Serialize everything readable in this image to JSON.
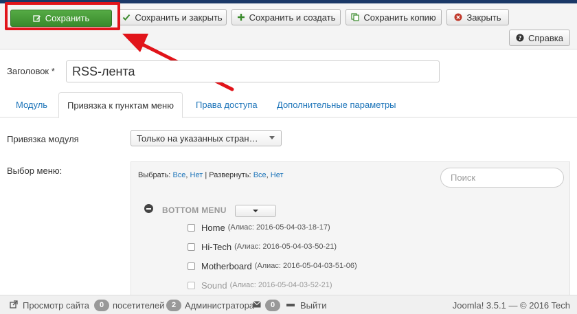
{
  "toolbar": {
    "save_label": "Сохранить",
    "save_close_label": "Сохранить и закрыть",
    "save_new_label": "Сохранить и создать",
    "save_copy_label": "Сохранить копию",
    "close_label": "Закрыть",
    "help_label": "Справка"
  },
  "form": {
    "title_label": "Заголовок *",
    "title_value": "RSS-лента"
  },
  "tabs": [
    {
      "label": "Модуль"
    },
    {
      "label": "Привязка к пунктам меню"
    },
    {
      "label": "Права доступа"
    },
    {
      "label": "Дополнительные параметры"
    }
  ],
  "assignment": {
    "label": "Привязка модуля",
    "selected": "Только на указанных стран…"
  },
  "menu_select": {
    "label": "Выбор меню:",
    "select_prefix": "Выбрать:",
    "all": "Все",
    "none": "Нет",
    "expand_prefix": "Развернуть:",
    "separator": "|",
    "comma": ",",
    "search_placeholder": "Поиск",
    "menu_title": "BOTTOM MENU",
    "items": [
      {
        "name": "Home",
        "alias": "(Алиас: 2016-05-04-03-18-17)"
      },
      {
        "name": "Hi-Tech",
        "alias": "(Алиас: 2016-05-04-03-50-21)"
      },
      {
        "name": "Motherboard",
        "alias": "(Алиас: 2016-05-04-03-51-06)"
      },
      {
        "name": "Sound",
        "alias": "(Алиас: 2016-05-04-03-52-21)"
      }
    ]
  },
  "status": {
    "view_site": "Просмотр сайта",
    "visitors_count": "0",
    "visitors_label": "посетителей",
    "admins_count": "2",
    "admins_label": "Администратора",
    "messages_count": "0",
    "logout_label": "Выйти",
    "footer": "Joomla! 3.5.1 — © 2016 Tech"
  },
  "colors": {
    "save_green": "#46a036",
    "highlight_red": "#e1141a",
    "link_blue": "#1c74b9",
    "header_navy": "#1a3867"
  }
}
